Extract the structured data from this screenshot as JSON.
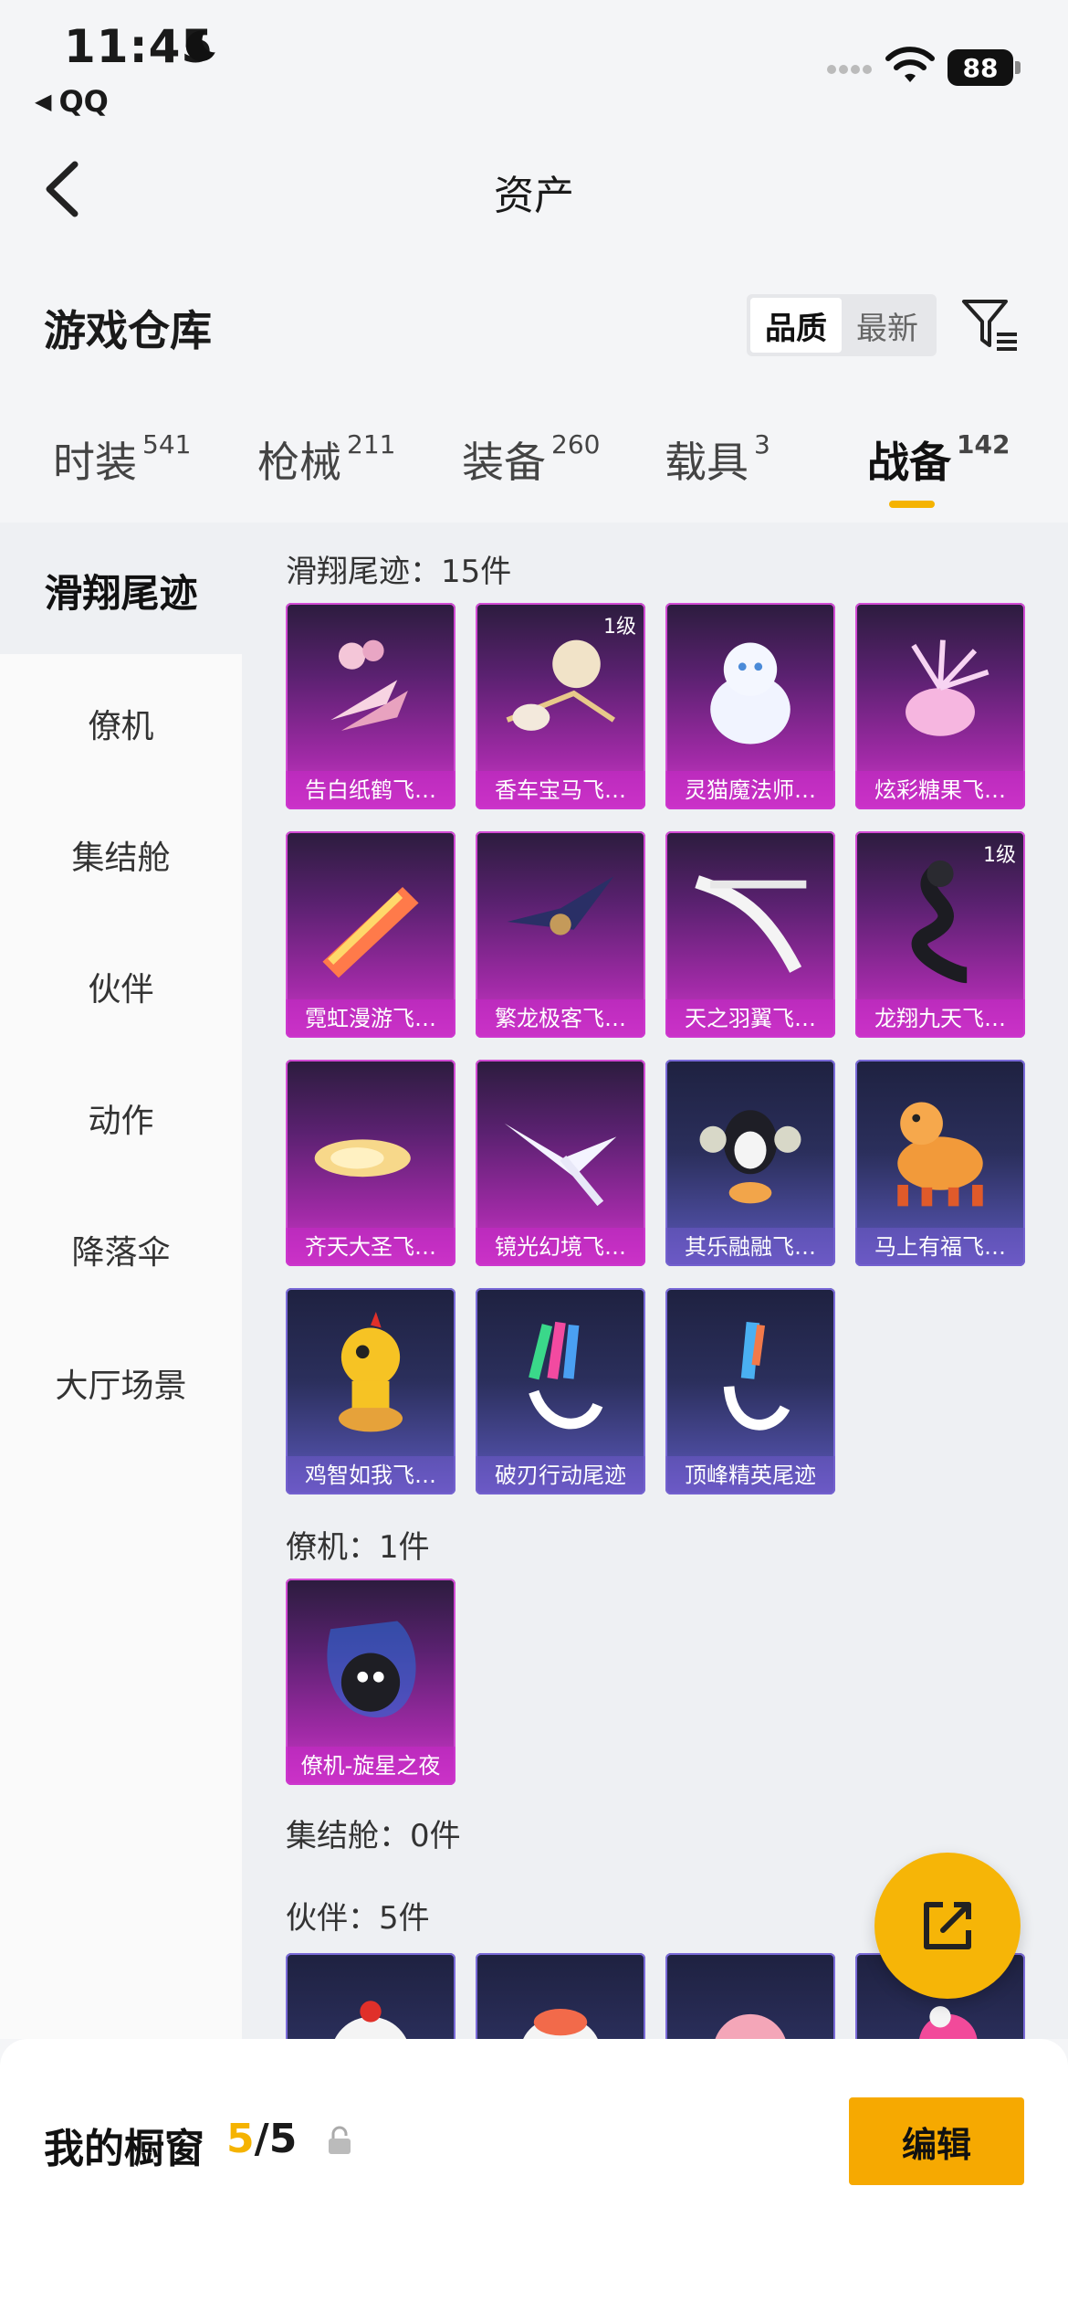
{
  "status_bar": {
    "time": "11:45",
    "back_app": "QQ",
    "battery": "88"
  },
  "nav": {
    "title": "资产"
  },
  "header": {
    "title": "游戏仓库",
    "sort_options": [
      "品质",
      "最新"
    ],
    "sort_selected": "品质"
  },
  "tabs": [
    {
      "label": "时装",
      "count": "541"
    },
    {
      "label": "枪械",
      "count": "211"
    },
    {
      "label": "装备",
      "count": "260"
    },
    {
      "label": "载具",
      "count": "3"
    },
    {
      "label": "战备",
      "count": "142"
    }
  ],
  "active_tab": "战备",
  "sidebar": {
    "items": [
      "滑翔尾迹",
      "僚机",
      "集结舱",
      "伙伴",
      "动作",
      "降落伞",
      "大厅场景"
    ],
    "active": "滑翔尾迹"
  },
  "groups": {
    "trails": {
      "label": "滑翔尾迹：15件",
      "items": [
        {
          "name": "告白纸鹤飞…",
          "rarity": "purple",
          "level": ""
        },
        {
          "name": "香车宝马飞…",
          "rarity": "purple",
          "level": "1级"
        },
        {
          "name": "灵猫魔法师…",
          "rarity": "purple",
          "level": ""
        },
        {
          "name": "炫彩糖果飞…",
          "rarity": "purple",
          "level": ""
        },
        {
          "name": "霓虹漫游飞…",
          "rarity": "purple",
          "level": ""
        },
        {
          "name": "繁龙极客飞…",
          "rarity": "purple",
          "level": ""
        },
        {
          "name": "天之羽翼飞…",
          "rarity": "purple",
          "level": ""
        },
        {
          "name": "龙翔九天飞…",
          "rarity": "purple",
          "level": "1级"
        },
        {
          "name": "齐天大圣飞…",
          "rarity": "purple",
          "level": ""
        },
        {
          "name": "镜光幻境飞…",
          "rarity": "purple",
          "level": ""
        },
        {
          "name": "其乐融融飞…",
          "rarity": "blue",
          "level": ""
        },
        {
          "name": "马上有福飞…",
          "rarity": "blue",
          "level": ""
        },
        {
          "name": "鸡智如我飞…",
          "rarity": "blue",
          "level": ""
        },
        {
          "name": "破刃行动尾迹",
          "rarity": "blue",
          "level": ""
        },
        {
          "name": "顶峰精英尾迹",
          "rarity": "blue",
          "level": ""
        }
      ]
    },
    "wingman": {
      "label": "僚机：1件",
      "items": [
        {
          "name": "僚机-旋星之夜",
          "rarity": "purple",
          "level": ""
        }
      ]
    },
    "pod": {
      "label": "集结舱：0件"
    },
    "partner": {
      "label": "伙伴：5件",
      "items": [
        {
          "name": "",
          "rarity": "blue",
          "level": ""
        },
        {
          "name": "",
          "rarity": "blue",
          "level": ""
        },
        {
          "name": "",
          "rarity": "blue",
          "level": ""
        },
        {
          "name": "",
          "rarity": "blue",
          "level": ""
        }
      ]
    }
  },
  "bottom": {
    "showcase_label": "我的橱窗",
    "showcase_current": "5",
    "showcase_total": "/5",
    "edit_label": "编辑"
  },
  "colors": {
    "accent": "#f5b301",
    "purple_card": "#a02aa6",
    "blue_card": "#4a4a9a"
  }
}
